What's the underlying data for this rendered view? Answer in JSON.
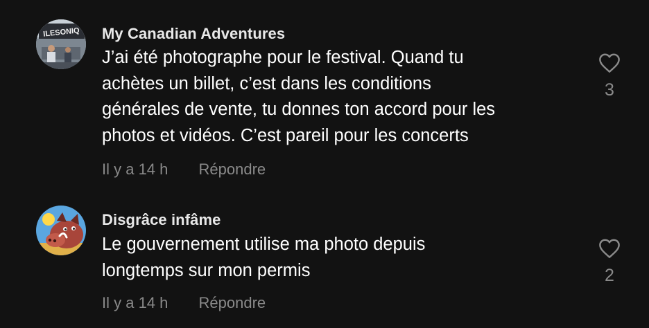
{
  "comments": [
    {
      "author": "My Canadian Adventures",
      "avatar_label": "ILESONIQ",
      "lines": [
        "J’ai été photographe pour le festival. Quand tu",
        "achètes un billet, c’est dans les conditions",
        "générales de vente, tu donnes ton accord pour les",
        "photos et vidéos. C’est pareil pour les concerts"
      ],
      "time": "Il y a 14 h",
      "reply": "Répondre",
      "likes": "3",
      "like_icon": "heart-outline-icon"
    },
    {
      "author": "Disgrâce infâme",
      "avatar_icon": "warthog-cartoon-avatar",
      "lines": [
        "Le gouvernement utilise ma photo depuis",
        "longtemps sur mon permis"
      ],
      "time": "Il y a 14 h",
      "reply": "Répondre",
      "likes": "2",
      "like_icon": "heart-outline-icon"
    }
  ],
  "colors": {
    "background": "#121212",
    "text": "#ffffff",
    "muted": "#8a8a8a"
  }
}
